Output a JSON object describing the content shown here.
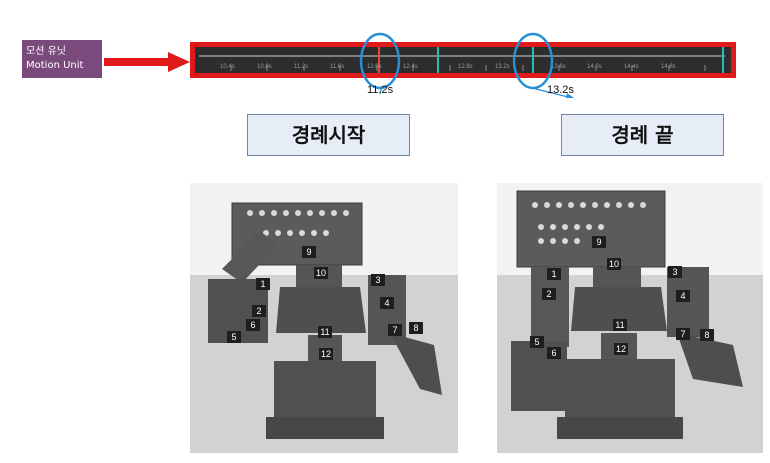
{
  "motion_unit": {
    "line1": "모션 유닛",
    "line2": "Motion Unit"
  },
  "timeline": {
    "tick_labels": [
      "10.4s",
      "10.8s",
      "11.2s",
      "11.6s",
      "12.0s",
      "12.4s",
      "12.8s",
      "13.2s",
      "13.6s",
      "14.0s",
      "14.4s",
      "14.8s"
    ]
  },
  "markers": {
    "start_time": "11.2s",
    "end_time": "13.2s"
  },
  "callouts": {
    "start": "경례시작",
    "end": "경례 끝"
  },
  "robot_left": {
    "tags": [
      "1",
      "2",
      "3",
      "4",
      "5",
      "6",
      "7",
      "8",
      "9",
      "10",
      "11",
      "12"
    ]
  },
  "robot_right": {
    "tags": [
      "1",
      "2",
      "3",
      "4",
      "5",
      "6",
      "7",
      "8",
      "9",
      "10",
      "11",
      "12"
    ]
  },
  "colors": {
    "frame": "#e01a1a",
    "label_bg": "#7a4a7c",
    "marker_circle": "#2a8fd6",
    "keyframe": "#2bbcb4",
    "playhead": "#e8463a"
  }
}
